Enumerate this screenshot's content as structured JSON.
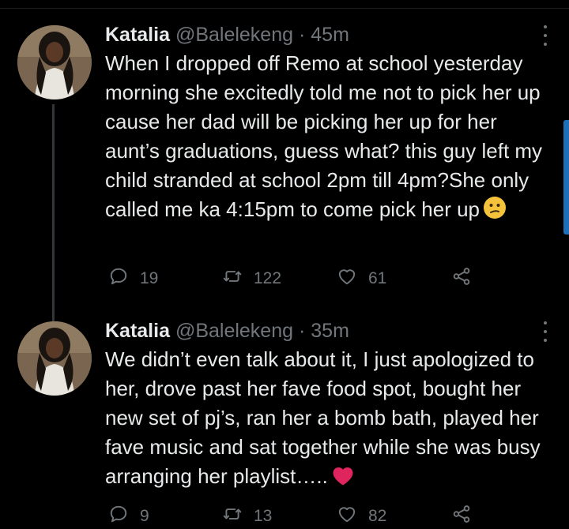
{
  "tweets": [
    {
      "name": "Katalia",
      "handle": "@Balelekeng",
      "time": "45m",
      "text": "When I dropped off Remo at school yesterday morning she excitedly told me not to pick her up cause her dad will be picking her up for her aunt’s graduations, guess what? this guy left my child stranded at school 2pm till 4pm?She only called me ka 4:15pm to come pick her up",
      "emoji": "confused-face-icon",
      "replies": "19",
      "retweets": "122",
      "likes": "61"
    },
    {
      "name": "Katalia",
      "handle": "@Balelekeng",
      "time": "35m",
      "text": "We didn’t even talk about it, I just apologized to her, drove past her fave food spot, bought her new set of pj’s, ran her a bomb bath, played her fave music and sat together while she was busy arranging her playlist…..",
      "emoji": "red-heart-icon",
      "replies": "9",
      "retweets": "13",
      "likes": "82"
    }
  ],
  "separator": "·",
  "colors": {
    "background": "#000000",
    "text": "#e7e9ea",
    "muted": "#71767b",
    "heart": "#e0245e",
    "scroll_accent": "#1d6fb8"
  }
}
